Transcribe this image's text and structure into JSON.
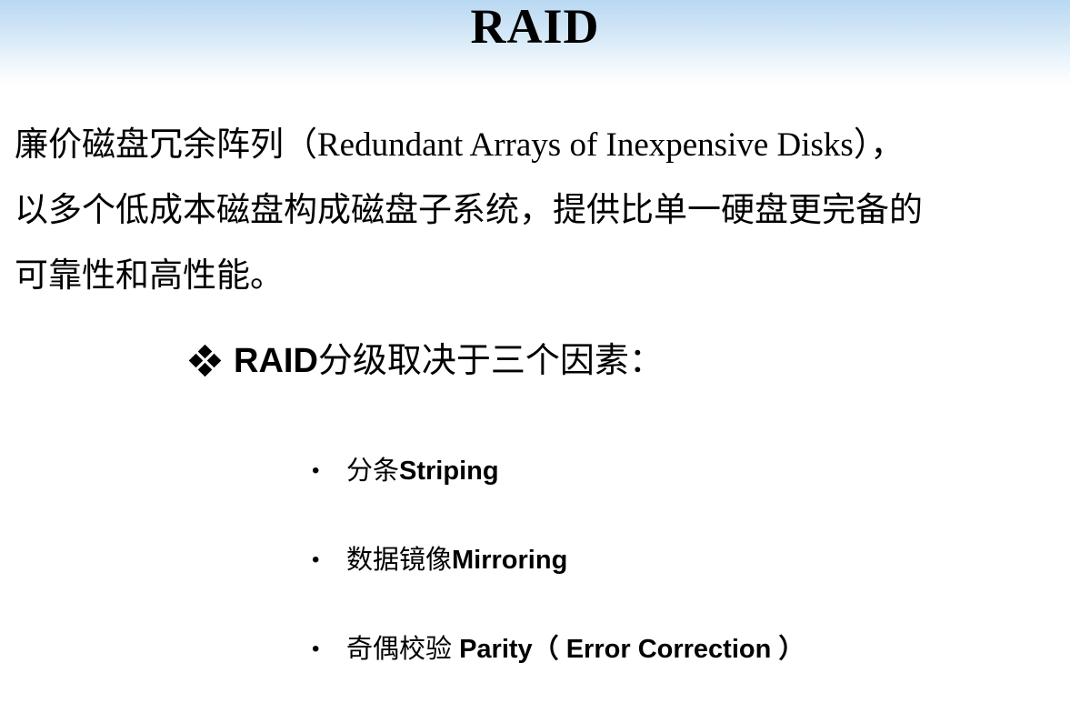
{
  "slide": {
    "title": "RAID",
    "intro_lines": [
      "廉价磁盘冗余阵列（Redundant Arrays of Inexpensive Disks），",
      "以多个低成本磁盘构成磁盘子系统，提供比单一硬盘更完备的",
      "可靠性和高性能。"
    ],
    "subhead": {
      "icon": "four-diamond-bullet-icon",
      "prefix": "RAID",
      "text": "分级取决于三个因素："
    },
    "factors": [
      {
        "cn": "分条",
        "en": "Striping"
      },
      {
        "cn": "数据镜像",
        "en": "Mirroring"
      },
      {
        "cn": "奇偶校验 ",
        "en": "Parity（ Error Correction ）"
      }
    ],
    "bullet_glyph": "•"
  },
  "colors": {
    "title_band_top": "#b9d8f2",
    "title_band_bottom": "#ffffff",
    "text": "#000000"
  }
}
